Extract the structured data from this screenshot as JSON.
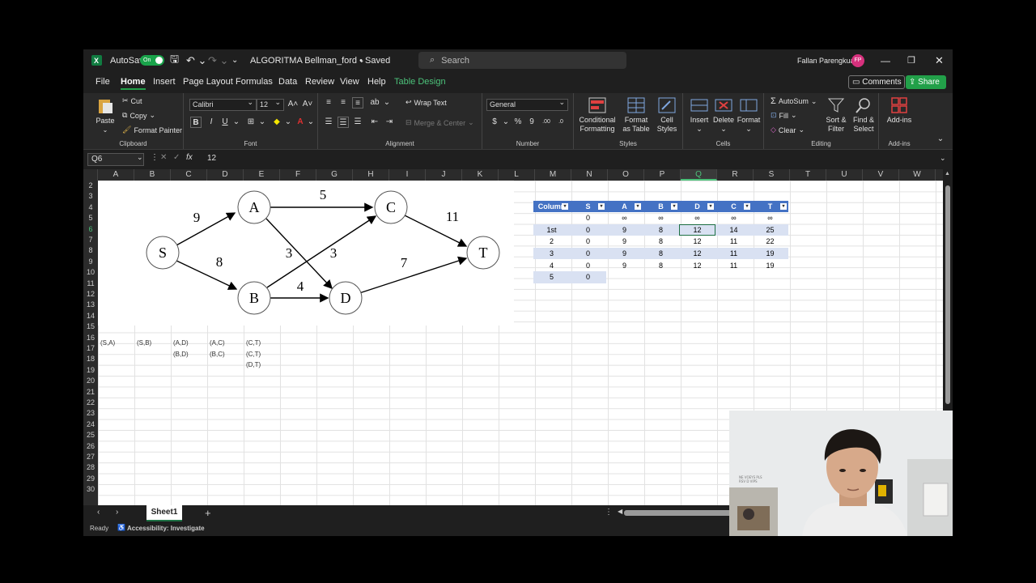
{
  "titlebar": {
    "autosave_label": "AutoSave",
    "autosave_state": "On",
    "doc_title": "ALGORITMA Bellman_ford • Saved",
    "search_placeholder": "Search",
    "user_name": "Fallan Parengkuan",
    "user_initials": "FP",
    "avatar_color": "#d6317d"
  },
  "menu": {
    "items": [
      "File",
      "Home",
      "Insert",
      "Page Layout",
      "Formulas",
      "Data",
      "Review",
      "View",
      "Help",
      "Table Design"
    ],
    "active": "Home",
    "comments_label": "Comments",
    "share_label": "Share"
  },
  "ribbon": {
    "clipboard": {
      "paste": "Paste",
      "cut": "Cut",
      "copy": "Copy",
      "format_painter": "Format Painter",
      "label": "Clipboard"
    },
    "font": {
      "family": "Calibri",
      "size": "12",
      "label": "Font",
      "bold": "B",
      "italic": "I",
      "underline": "U"
    },
    "alignment": {
      "wrap_text": "Wrap Text",
      "merge_center": "Merge & Center",
      "label": "Alignment"
    },
    "number": {
      "format": "General",
      "currency": "$",
      "percent": "%",
      "comma": "9",
      "label": "Number"
    },
    "styles": {
      "conditional": "Conditional Formatting",
      "format_table": "Format as Table",
      "cell_styles": "Cell Styles",
      "label": "Styles"
    },
    "cells": {
      "insert": "Insert",
      "delete": "Delete",
      "format": "Format",
      "label": "Cells"
    },
    "editing": {
      "autosum": "AutoSum",
      "fill": "Fill",
      "clear": "Clear",
      "sort_filter": "Sort & Filter",
      "find_select": "Find & Select",
      "label": "Editing"
    },
    "addins": {
      "addins": "Add-ins",
      "label": "Add-ins"
    }
  },
  "formula_bar": {
    "cell_ref": "Q6",
    "fx": "fx",
    "value": "12"
  },
  "columns": [
    "A",
    "B",
    "C",
    "D",
    "E",
    "F",
    "G",
    "H",
    "I",
    "J",
    "K",
    "L",
    "M",
    "N",
    "O",
    "P",
    "Q",
    "R",
    "S",
    "T",
    "U",
    "V",
    "W"
  ],
  "selected_column": "Q",
  "rows": [
    "2",
    "3",
    "4",
    "5",
    "6",
    "7",
    "8",
    "9",
    "10",
    "11",
    "12",
    "13",
    "14",
    "15",
    "16",
    "17",
    "18",
    "19",
    "20",
    "21",
    "22",
    "23",
    "24",
    "25",
    "26",
    "27",
    "28",
    "29",
    "30"
  ],
  "selected_row": "6",
  "graph": {
    "nodes": [
      "S",
      "A",
      "B",
      "C",
      "D",
      "T"
    ],
    "weights": {
      "SA": "9",
      "SB": "8",
      "AC": "5",
      "AD": "3",
      "BC": "3",
      "BD": "4",
      "CT": "11",
      "DT": "7"
    }
  },
  "edges_list": {
    "A": [
      "(S,A)"
    ],
    "B": [
      "(S,B)"
    ],
    "C": [
      "(A,D)",
      "(B,D)"
    ],
    "D": [
      "(A,C)",
      "(B,C)"
    ],
    "E": [
      "(C,T)",
      "(C,T)",
      "(D,T)"
    ]
  },
  "table": {
    "headers": [
      "Column",
      "S",
      "A",
      "B",
      "D",
      "C",
      "T"
    ],
    "rows": [
      [
        "",
        "0",
        "∞",
        "∞",
        "∞",
        "∞",
        "∞"
      ],
      [
        "1st",
        "0",
        "9",
        "8",
        "12",
        "14",
        "25"
      ],
      [
        "2",
        "0",
        "9",
        "8",
        "12",
        "11",
        "22"
      ],
      [
        "3",
        "0",
        "9",
        "8",
        "12",
        "11",
        "19"
      ],
      [
        "4",
        "0",
        "9",
        "8",
        "12",
        "11",
        "19"
      ],
      [
        "5",
        "0",
        "",
        "",
        "",
        "",
        ""
      ]
    ],
    "header_color": "#4472c4",
    "band_color": "#d9e1f2"
  },
  "sheets": {
    "active": "Sheet1",
    "add": "+"
  },
  "status": {
    "ready": "Ready",
    "accessibility": "Accessibility: Investigate"
  },
  "webcam": {
    "poster_text": "NE VOEYS PLS\nRSV D VIPS"
  }
}
